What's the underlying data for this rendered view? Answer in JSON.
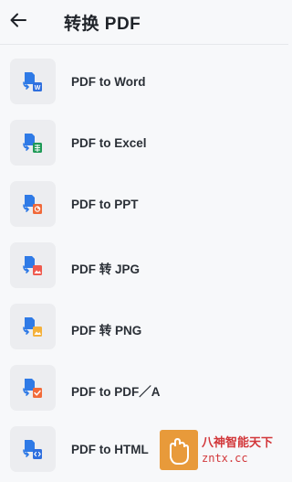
{
  "header": {
    "title": "转换 PDF",
    "back_icon": "arrow-left-icon"
  },
  "items": [
    {
      "label": "PDF to Word",
      "badge": "W",
      "badge_color": "#2f6fde",
      "icon": "pdf-to-word-icon"
    },
    {
      "label": "PDF to Excel",
      "badge": "",
      "badge_color": "#1f9a57",
      "icon": "pdf-to-excel-icon"
    },
    {
      "label": "PDF to PPT",
      "badge": "",
      "badge_color": "#f0693a",
      "icon": "pdf-to-ppt-icon"
    },
    {
      "label": "PDF 转 JPG",
      "badge": "",
      "badge_color": "#ef5a4e",
      "icon": "pdf-to-jpg-icon"
    },
    {
      "label": "PDF 转 PNG",
      "badge": "",
      "badge_color": "#f4b13c",
      "icon": "pdf-to-png-icon"
    },
    {
      "label": "PDF to PDF／A",
      "badge": "",
      "badge_color": "#f26b3a",
      "icon": "pdf-to-pdfa-icon"
    },
    {
      "label": "PDF to HTML",
      "badge": "",
      "badge_color": "#2f6fde",
      "icon": "pdf-to-html-icon"
    }
  ],
  "watermark": {
    "line1": "八神智能天下",
    "line2": "zntx.cc"
  },
  "colors": {
    "doc_blue": "#2f7ae6",
    "arrow_blue": "#2f7ae6",
    "background": "#f7f8fa",
    "icon_tile": "#ecedf0"
  }
}
